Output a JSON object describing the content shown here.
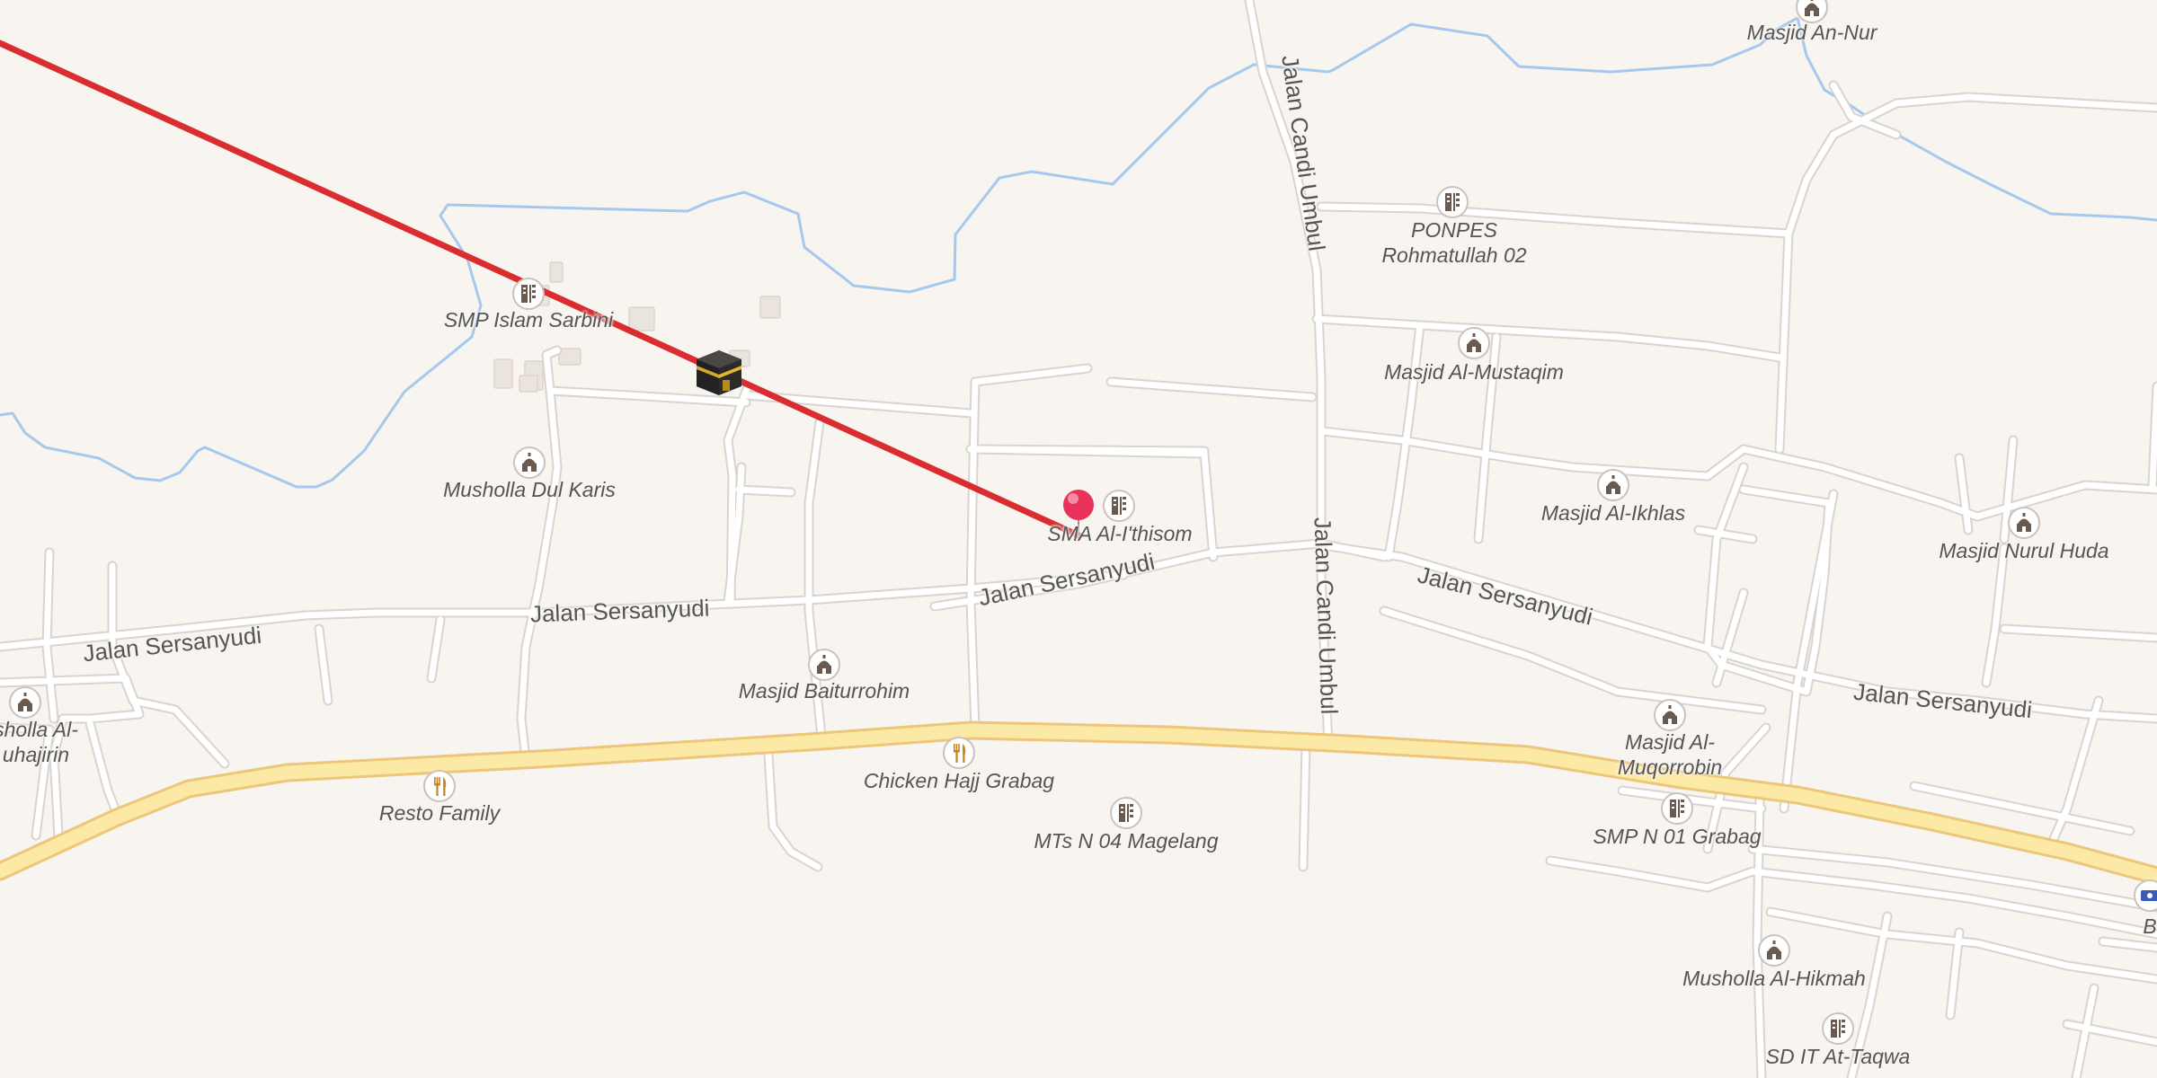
{
  "map": {
    "colors": {
      "background": "#f8f4f0",
      "minor_road": "#ffffff",
      "road_casing": "#d9d4cf",
      "primary_road": "#fde9a6",
      "primary_casing": "#ecc67a",
      "waterway": "#a5c9ee",
      "qibla_line": "#d92d30",
      "location_pin": "#e8325a",
      "poi_icon": "#6b5a50",
      "food_icon": "#c7851d"
    },
    "markers": {
      "kaaba": "kaaba-icon",
      "current_location": "location-pin-icon"
    },
    "streets": [
      {
        "id": "sersanyudi-1",
        "text": "Jalan Sersanyudi"
      },
      {
        "id": "sersanyudi-2",
        "text": "Jalan Sersanyudi"
      },
      {
        "id": "sersanyudi-3",
        "text": "Jalan Sersanyudi"
      },
      {
        "id": "sersanyudi-4",
        "text": "Jalan Sersanyudi"
      },
      {
        "id": "sersanyudi-5",
        "text": "Jalan Sersanyudi"
      },
      {
        "id": "candi-umbul-1",
        "text": "Jalan Candi Umbul"
      },
      {
        "id": "candi-umbul-2",
        "text": "Jalan Candi Umbul"
      }
    ],
    "pois": [
      {
        "id": "masjid-an-nur",
        "type": "mosque-icon",
        "label": "Masjid An-Nur"
      },
      {
        "id": "ponpes",
        "type": "school-icon",
        "label": "PONPES\nRohmatullah 02"
      },
      {
        "id": "smp-islam-sarbini",
        "type": "school-icon",
        "label": "SMP Islam Sarbini"
      },
      {
        "id": "masjid-al-mustaqim",
        "type": "mosque-icon",
        "label": "Masjid Al-Mustaqim"
      },
      {
        "id": "musholla-dul-karis",
        "type": "mosque-icon",
        "label": "Musholla Dul Karis"
      },
      {
        "id": "sma-al-ithisom",
        "type": "school-icon",
        "label": "SMA Al-I'thisom"
      },
      {
        "id": "masjid-al-ikhlas",
        "type": "mosque-icon",
        "label": "Masjid Al-Ikhlas"
      },
      {
        "id": "masjid-nurul-huda",
        "type": "mosque-icon",
        "label": "Masjid Nurul Huda"
      },
      {
        "id": "masjid-baiturrohim",
        "type": "mosque-icon",
        "label": "Masjid Baiturrohim"
      },
      {
        "id": "musholla-al-muhajirin",
        "type": "mosque-icon",
        "label": "sholla Al-\nuhajirin"
      },
      {
        "id": "masjid-al-muqorrobin",
        "type": "mosque-icon",
        "label": "Masjid Al-\nMuqorrobin"
      },
      {
        "id": "chicken-hajj",
        "type": "restaurant-icon",
        "label": "Chicken Hajj Grabag"
      },
      {
        "id": "resto-family",
        "type": "restaurant-icon",
        "label": "Resto Family"
      },
      {
        "id": "mts-n-04",
        "type": "school-icon",
        "label": "MTs N 04 Magelang"
      },
      {
        "id": "smp-n-01",
        "type": "school-icon",
        "label": "SMP N 01 Grabag"
      },
      {
        "id": "musholla-al-hikmah",
        "type": "mosque-icon",
        "label": "Musholla Al-Hikmah"
      },
      {
        "id": "sd-it-at-taqwa",
        "type": "school-icon",
        "label": "SD IT At-Taqwa"
      },
      {
        "id": "bank-partial",
        "type": "bank-icon",
        "label": "B"
      }
    ]
  }
}
